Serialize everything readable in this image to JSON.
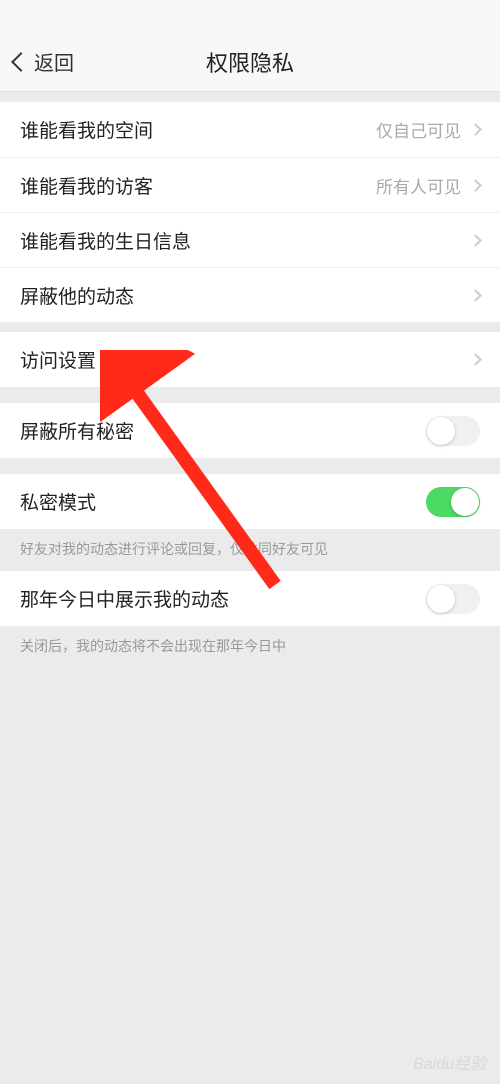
{
  "status_bar": {
    "text": ""
  },
  "header": {
    "back_label": "返回",
    "title": "权限隐私"
  },
  "group1": [
    {
      "label": "谁能看我的空间",
      "value": "仅自己可见"
    },
    {
      "label": "谁能看我的访客",
      "value": "所有人可见"
    },
    {
      "label": "谁能看我的生日信息",
      "value": ""
    },
    {
      "label": "屏蔽他的动态",
      "value": ""
    }
  ],
  "access": {
    "label": "访问设置"
  },
  "toggles": {
    "hide_secrets": {
      "label": "屏蔽所有秘密",
      "on": false
    },
    "private_mode": {
      "label": "私密模式",
      "on": true,
      "hint": "好友对我的动态进行评论或回复，仅共同好友可见"
    },
    "show_memories": {
      "label": "那年今日中展示我的动态",
      "on": false,
      "hint": "关闭后，我的动态将不会出现在那年今日中"
    }
  },
  "watermark": "Baidu经验"
}
